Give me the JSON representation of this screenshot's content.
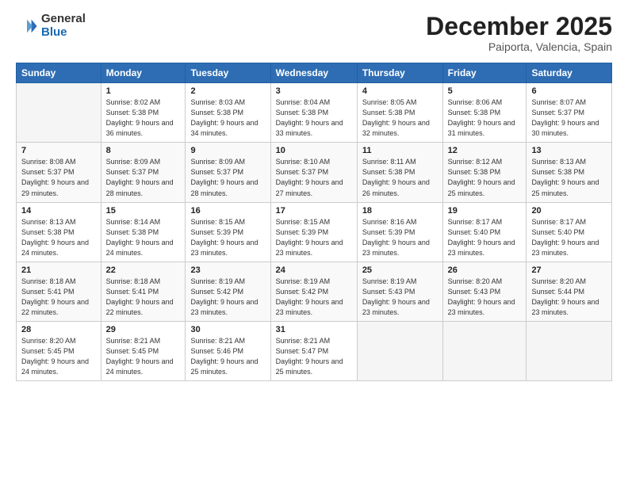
{
  "logo": {
    "general": "General",
    "blue": "Blue"
  },
  "title": "December 2025",
  "location": "Paiporta, Valencia, Spain",
  "weekdays": [
    "Sunday",
    "Monday",
    "Tuesday",
    "Wednesday",
    "Thursday",
    "Friday",
    "Saturday"
  ],
  "weeks": [
    [
      {
        "day": "",
        "sunrise": "",
        "sunset": "",
        "daylight": ""
      },
      {
        "day": "1",
        "sunrise": "Sunrise: 8:02 AM",
        "sunset": "Sunset: 5:38 PM",
        "daylight": "Daylight: 9 hours and 36 minutes."
      },
      {
        "day": "2",
        "sunrise": "Sunrise: 8:03 AM",
        "sunset": "Sunset: 5:38 PM",
        "daylight": "Daylight: 9 hours and 34 minutes."
      },
      {
        "day": "3",
        "sunrise": "Sunrise: 8:04 AM",
        "sunset": "Sunset: 5:38 PM",
        "daylight": "Daylight: 9 hours and 33 minutes."
      },
      {
        "day": "4",
        "sunrise": "Sunrise: 8:05 AM",
        "sunset": "Sunset: 5:38 PM",
        "daylight": "Daylight: 9 hours and 32 minutes."
      },
      {
        "day": "5",
        "sunrise": "Sunrise: 8:06 AM",
        "sunset": "Sunset: 5:38 PM",
        "daylight": "Daylight: 9 hours and 31 minutes."
      },
      {
        "day": "6",
        "sunrise": "Sunrise: 8:07 AM",
        "sunset": "Sunset: 5:37 PM",
        "daylight": "Daylight: 9 hours and 30 minutes."
      }
    ],
    [
      {
        "day": "7",
        "sunrise": "Sunrise: 8:08 AM",
        "sunset": "Sunset: 5:37 PM",
        "daylight": "Daylight: 9 hours and 29 minutes."
      },
      {
        "day": "8",
        "sunrise": "Sunrise: 8:09 AM",
        "sunset": "Sunset: 5:37 PM",
        "daylight": "Daylight: 9 hours and 28 minutes."
      },
      {
        "day": "9",
        "sunrise": "Sunrise: 8:09 AM",
        "sunset": "Sunset: 5:37 PM",
        "daylight": "Daylight: 9 hours and 28 minutes."
      },
      {
        "day": "10",
        "sunrise": "Sunrise: 8:10 AM",
        "sunset": "Sunset: 5:37 PM",
        "daylight": "Daylight: 9 hours and 27 minutes."
      },
      {
        "day": "11",
        "sunrise": "Sunrise: 8:11 AM",
        "sunset": "Sunset: 5:38 PM",
        "daylight": "Daylight: 9 hours and 26 minutes."
      },
      {
        "day": "12",
        "sunrise": "Sunrise: 8:12 AM",
        "sunset": "Sunset: 5:38 PM",
        "daylight": "Daylight: 9 hours and 25 minutes."
      },
      {
        "day": "13",
        "sunrise": "Sunrise: 8:13 AM",
        "sunset": "Sunset: 5:38 PM",
        "daylight": "Daylight: 9 hours and 25 minutes."
      }
    ],
    [
      {
        "day": "14",
        "sunrise": "Sunrise: 8:13 AM",
        "sunset": "Sunset: 5:38 PM",
        "daylight": "Daylight: 9 hours and 24 minutes."
      },
      {
        "day": "15",
        "sunrise": "Sunrise: 8:14 AM",
        "sunset": "Sunset: 5:38 PM",
        "daylight": "Daylight: 9 hours and 24 minutes."
      },
      {
        "day": "16",
        "sunrise": "Sunrise: 8:15 AM",
        "sunset": "Sunset: 5:39 PM",
        "daylight": "Daylight: 9 hours and 23 minutes."
      },
      {
        "day": "17",
        "sunrise": "Sunrise: 8:15 AM",
        "sunset": "Sunset: 5:39 PM",
        "daylight": "Daylight: 9 hours and 23 minutes."
      },
      {
        "day": "18",
        "sunrise": "Sunrise: 8:16 AM",
        "sunset": "Sunset: 5:39 PM",
        "daylight": "Daylight: 9 hours and 23 minutes."
      },
      {
        "day": "19",
        "sunrise": "Sunrise: 8:17 AM",
        "sunset": "Sunset: 5:40 PM",
        "daylight": "Daylight: 9 hours and 23 minutes."
      },
      {
        "day": "20",
        "sunrise": "Sunrise: 8:17 AM",
        "sunset": "Sunset: 5:40 PM",
        "daylight": "Daylight: 9 hours and 23 minutes."
      }
    ],
    [
      {
        "day": "21",
        "sunrise": "Sunrise: 8:18 AM",
        "sunset": "Sunset: 5:41 PM",
        "daylight": "Daylight: 9 hours and 22 minutes."
      },
      {
        "day": "22",
        "sunrise": "Sunrise: 8:18 AM",
        "sunset": "Sunset: 5:41 PM",
        "daylight": "Daylight: 9 hours and 22 minutes."
      },
      {
        "day": "23",
        "sunrise": "Sunrise: 8:19 AM",
        "sunset": "Sunset: 5:42 PM",
        "daylight": "Daylight: 9 hours and 23 minutes."
      },
      {
        "day": "24",
        "sunrise": "Sunrise: 8:19 AM",
        "sunset": "Sunset: 5:42 PM",
        "daylight": "Daylight: 9 hours and 23 minutes."
      },
      {
        "day": "25",
        "sunrise": "Sunrise: 8:19 AM",
        "sunset": "Sunset: 5:43 PM",
        "daylight": "Daylight: 9 hours and 23 minutes."
      },
      {
        "day": "26",
        "sunrise": "Sunrise: 8:20 AM",
        "sunset": "Sunset: 5:43 PM",
        "daylight": "Daylight: 9 hours and 23 minutes."
      },
      {
        "day": "27",
        "sunrise": "Sunrise: 8:20 AM",
        "sunset": "Sunset: 5:44 PM",
        "daylight": "Daylight: 9 hours and 23 minutes."
      }
    ],
    [
      {
        "day": "28",
        "sunrise": "Sunrise: 8:20 AM",
        "sunset": "Sunset: 5:45 PM",
        "daylight": "Daylight: 9 hours and 24 minutes."
      },
      {
        "day": "29",
        "sunrise": "Sunrise: 8:21 AM",
        "sunset": "Sunset: 5:45 PM",
        "daylight": "Daylight: 9 hours and 24 minutes."
      },
      {
        "day": "30",
        "sunrise": "Sunrise: 8:21 AM",
        "sunset": "Sunset: 5:46 PM",
        "daylight": "Daylight: 9 hours and 25 minutes."
      },
      {
        "day": "31",
        "sunrise": "Sunrise: 8:21 AM",
        "sunset": "Sunset: 5:47 PM",
        "daylight": "Daylight: 9 hours and 25 minutes."
      },
      {
        "day": "",
        "sunrise": "",
        "sunset": "",
        "daylight": ""
      },
      {
        "day": "",
        "sunrise": "",
        "sunset": "",
        "daylight": ""
      },
      {
        "day": "",
        "sunrise": "",
        "sunset": "",
        "daylight": ""
      }
    ]
  ]
}
